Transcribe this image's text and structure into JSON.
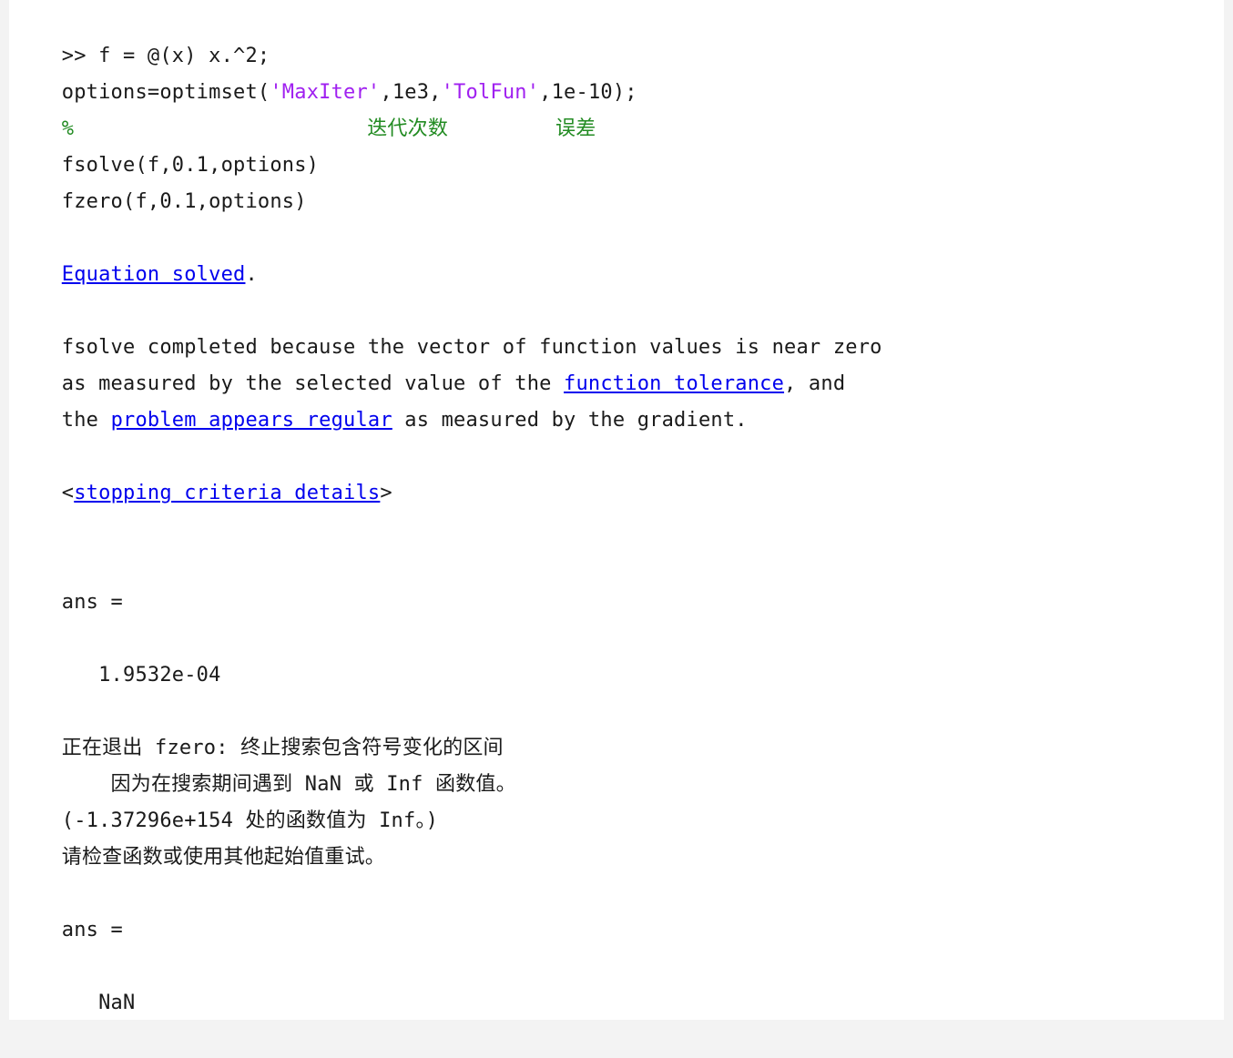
{
  "colors": {
    "string": "#a020f0",
    "comment": "#228b22",
    "link": "#0000ee",
    "text": "#1a1a1a",
    "background": "#ffffff"
  },
  "console": {
    "prompt": ">>",
    "cmd1": " f = @(x) x.^2;",
    "cmd2_pre": "options=optimset(",
    "cmd2_str1": "'MaxIter'",
    "cmd2_mid": ",1e3,",
    "cmd2_str2": "'TolFun'",
    "cmd2_post": ",1e-10);",
    "comment_mark": "%",
    "comment_a": "迭代次数",
    "comment_b": "误差",
    "cmd3": "fsolve(f,0.1,options)",
    "cmd4": "fzero(f,0.1,options)",
    "eq_solved_link": "Equation solved",
    "eq_solved_tail": ".",
    "msg1": "fsolve completed because the vector of function values is near zero",
    "msg2_pre": "as measured by the selected value of the ",
    "msg2_link": "function tolerance",
    "msg2_post": ", and",
    "msg3_pre": "the ",
    "msg3_link": "problem appears regular",
    "msg3_post": " as measured by the gradient.",
    "details_open": "<",
    "details_link": "stopping criteria details",
    "details_close": ">",
    "ans1_label": "ans =",
    "ans1_value": "   1.9532e-04",
    "fz1": "正在退出 fzero: 终止搜索包含符号变化的区间",
    "fz2": "    因为在搜索期间遇到 NaN 或 Inf 函数值。",
    "fz3": "(-1.37296e+154 处的函数值为 Inf。)",
    "fz4": "请检查函数或使用其他起始值重试。",
    "ans2_label": "ans =",
    "ans2_value": "   NaN"
  }
}
